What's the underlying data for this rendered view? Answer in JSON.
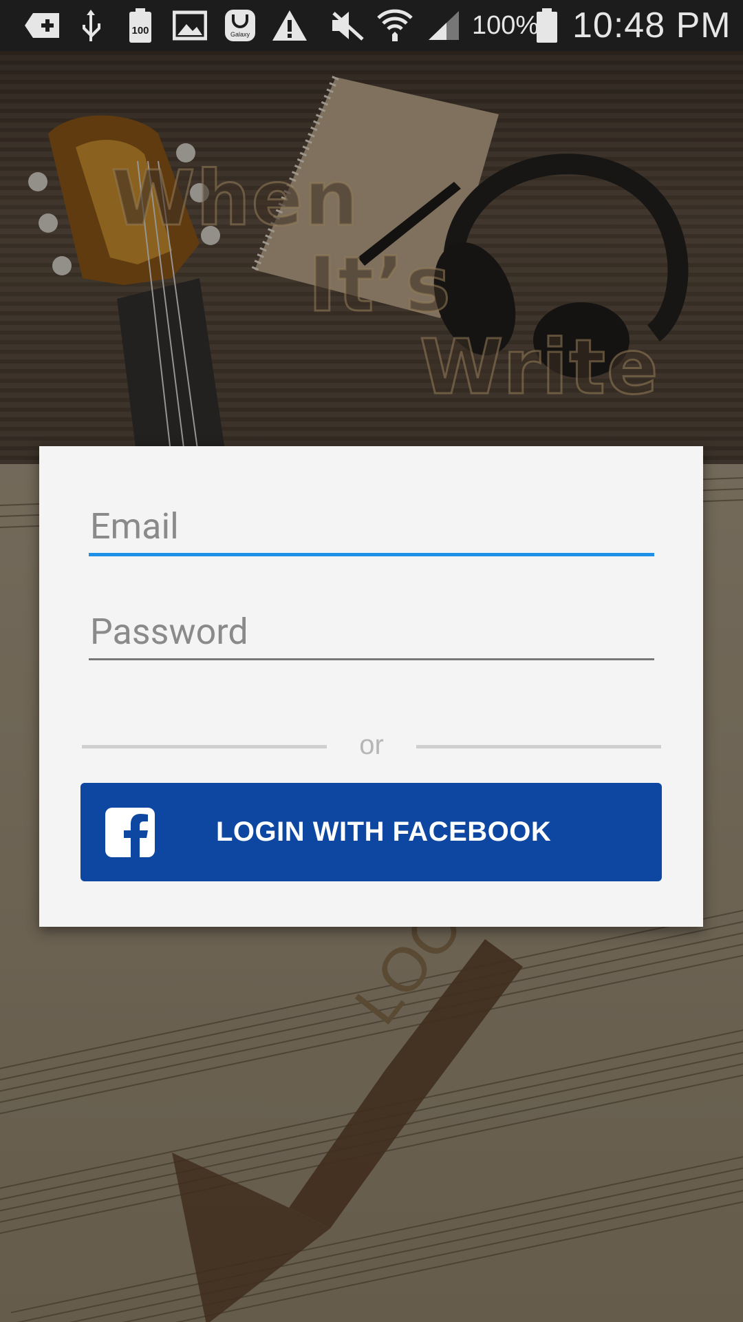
{
  "status_bar": {
    "icons": [
      "add-icon",
      "usb-icon",
      "battery-100-badge-icon",
      "gallery-icon",
      "galaxy-icon",
      "warning-icon",
      "mute-icon",
      "wifi-icon",
      "signal-icon",
      "battery-icon"
    ],
    "battery_level_text": "100%",
    "time": "10:48 PM"
  },
  "app": {
    "logo_words": [
      "When",
      "It’s",
      "Write"
    ],
    "background_badge_text": "LOO"
  },
  "login_form": {
    "email_placeholder": "Email",
    "password_placeholder": "Password",
    "divider_text": "or",
    "facebook_button_label": "LOGIN WITH FACEBOOK"
  },
  "colors": {
    "email_underline_active": "#1e90e8",
    "facebook_blue": "#0e47a1",
    "card_background": "#f4f4f4"
  }
}
